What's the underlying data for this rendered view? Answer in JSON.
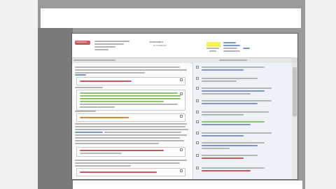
{
  "window": {
    "frame_color": "#9a9a9a",
    "canvas_color": "#f1f1f1",
    "page_color": "#ffffff"
  },
  "document": {
    "logo": "EXPERIAN",
    "header_text": "Document header",
    "title_center": "ASSESSMENT",
    "title_center_sub": "IN SUMMARY",
    "status_badge_color": "#f4f25a",
    "status_badge_text": "",
    "link_text": "View"
  },
  "viewer": {
    "toolbar_label": "Comments",
    "scroll_arrow_up": "▲",
    "scroll_arrow_down": "▼"
  },
  "colors": {
    "comment_blue": "#7e96c4",
    "comment_red": "#c9575b",
    "comment_green": "#8fc36b",
    "comment_orange": "#d9893b",
    "text_gray": "#b4b4b4",
    "highlight_green": "#cfe8b0"
  },
  "comments": {
    "count": 10
  }
}
